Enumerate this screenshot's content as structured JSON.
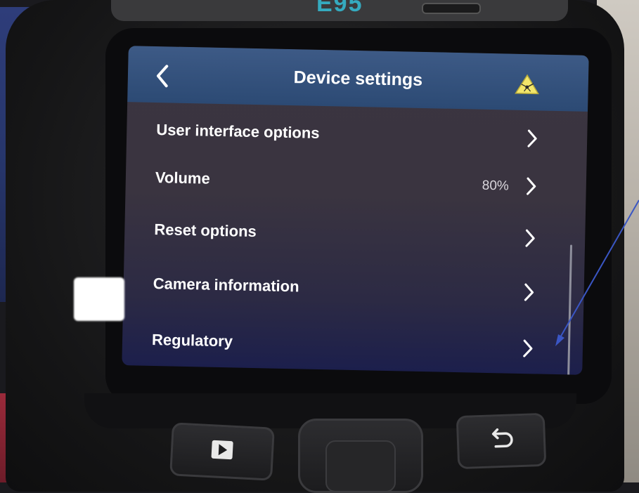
{
  "device": {
    "brand_label": "E95"
  },
  "header": {
    "title": "Device settings",
    "back_icon": "chevron-left-icon",
    "status_icon": "laser-warning-icon"
  },
  "menu": {
    "items": [
      {
        "label": "User interface options",
        "value": ""
      },
      {
        "label": "Volume",
        "value": "80%"
      },
      {
        "label": "Reset options",
        "value": ""
      },
      {
        "label": "Camera information",
        "value": ""
      },
      {
        "label": "Regulatory",
        "value": ""
      }
    ]
  },
  "buttons": {
    "play": "play-icon",
    "center": "navigation-pad",
    "back": "return-arrow-icon"
  },
  "colors": {
    "titlebar": "#2c4a74",
    "screen_bg": "#3a3440",
    "brand": "#35aabf",
    "warning": "#f3e66a",
    "annotation_arrow": "#3a56c4"
  }
}
